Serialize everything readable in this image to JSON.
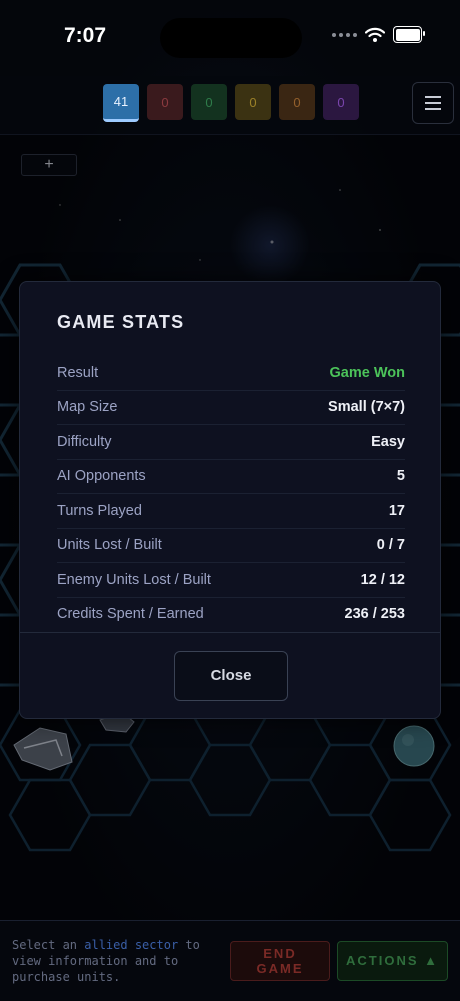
{
  "status_bar": {
    "time": "7:07"
  },
  "player_scores": [
    {
      "value": "41",
      "color": "#2d6fa8"
    },
    {
      "value": "0",
      "color": "#3a1a1d"
    },
    {
      "value": "0",
      "color": "#13321f"
    },
    {
      "value": "0",
      "color": "#3b3212"
    },
    {
      "value": "0",
      "color": "#3a2613"
    },
    {
      "value": "0",
      "color": "#2b1740"
    }
  ],
  "zoom_button": {
    "label": "+"
  },
  "stats_modal": {
    "title": "GAME STATS",
    "rows": [
      {
        "label": "Result",
        "value": "Game Won"
      },
      {
        "label": "Map Size",
        "value": "Small (7×7)"
      },
      {
        "label": "Difficulty",
        "value": "Easy"
      },
      {
        "label": "AI Opponents",
        "value": "5"
      },
      {
        "label": "Turns Played",
        "value": "17"
      },
      {
        "label": "Units Lost / Built",
        "value": "0 / 7"
      },
      {
        "label": "Enemy Units Lost / Built",
        "value": "12 / 12"
      },
      {
        "label": "Credits Spent / Earned",
        "value": "236 / 253"
      }
    ],
    "result_color": "#4cc35a",
    "close_label": "Close"
  },
  "bottom_bar": {
    "hint_before": "Select an ",
    "hint_highlight": "allied sector",
    "hint_after": " to view information and to purchase units.",
    "end_game_line1": "END",
    "end_game_line2": "GAME",
    "actions_label": "ACTIONS ▲"
  },
  "icons": [
    "menu-icon",
    "wifi-icon",
    "battery-icon",
    "signal-icon",
    "ship-icon",
    "planet-icon"
  ]
}
